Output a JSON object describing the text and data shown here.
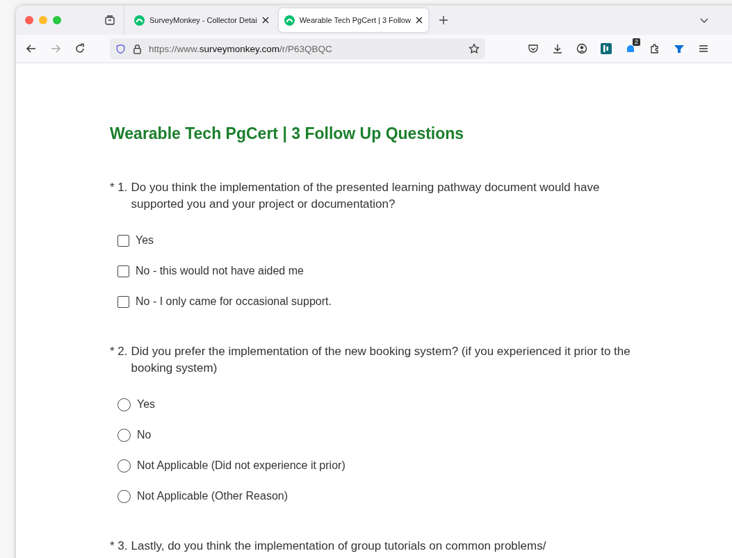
{
  "tabs": [
    {
      "title": "SurveyMonkey - Collector Detai",
      "selected": false
    },
    {
      "title": "Wearable Tech PgCert | 3 Follow",
      "selected": true
    }
  ],
  "address_bar": {
    "url_prefix": "https://www.",
    "url_domain": "surveymonkey.com",
    "url_path": "/r/P63QBQC"
  },
  "toolbar": {
    "notification_badge": "2"
  },
  "survey": {
    "title": "Wearable Tech PgCert | 3 Follow Up Questions",
    "questions": [
      {
        "number": "* 1.",
        "text": "Do you think the implementation of the presented learning pathway document would have supported you and your project or documentation?",
        "kind": "checkbox",
        "options": [
          {
            "label": "Yes",
            "checked": false
          },
          {
            "label": "No - this would not have aided me",
            "checked": false
          },
          {
            "label": "No - I only came for occasional support.",
            "checked": false
          }
        ]
      },
      {
        "number": "* 2.",
        "text": "Did you prefer the implementation of the new booking system? (if you experienced it prior to the booking system)",
        "kind": "radio",
        "options": [
          {
            "label": "Yes",
            "selected": false
          },
          {
            "label": "No",
            "selected": false
          },
          {
            "label": "Not Applicable (Did not experience it prior)",
            "selected": false
          },
          {
            "label": "Not Applicable (Other Reason)",
            "selected": false
          }
        ]
      },
      {
        "number": "* 3.",
        "text": "Lastly, do you think the implementation of group tutorials on common problems/",
        "kind": "partial"
      }
    ]
  }
}
